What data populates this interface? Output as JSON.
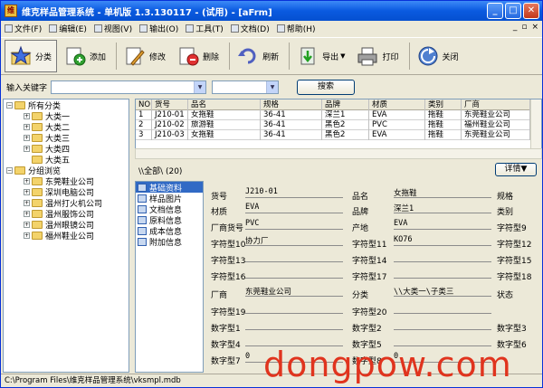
{
  "window": {
    "title": "维克样品管理系统 - 单机版 1.3.130117 - (试用) - [aFrm]"
  },
  "menu": [
    "文件(F)",
    "编辑(E)",
    "视图(V)",
    "输出(O)",
    "工具(T)",
    "文档(D)",
    "帮助(H)"
  ],
  "toolbar": {
    "classify": "分类",
    "add": "添加",
    "edit": "修改",
    "delete": "删除",
    "refresh": "刷新",
    "export": "导出",
    "print": "打印",
    "close": "关闭"
  },
  "search": {
    "label": "输入关键字",
    "button": "搜索",
    "value": "",
    "filter": ""
  },
  "tree": {
    "root1": "所有分类",
    "cats": [
      "大类一",
      "大类二",
      "大类三",
      "大类四",
      "大类五"
    ],
    "root2": "分组浏览",
    "groups": [
      "东莞鞋业公司",
      "深圳电脑公司",
      "温州打火机公司",
      "温州服饰公司",
      "温州眼镜公司",
      "福州鞋业公司"
    ]
  },
  "grid": {
    "headers": [
      "NO",
      "货号",
      "品名",
      "规格",
      "品牌",
      "材质",
      "类别",
      "厂商"
    ],
    "rows": [
      [
        "1",
        "J210-01",
        "女拖鞋",
        "36-41",
        "深兰1",
        "EVA",
        "拖鞋",
        "东莞鞋业公司"
      ],
      [
        "2",
        "J210-02",
        "旅游鞋",
        "36-41",
        "黑色2",
        "PVC",
        "拖鞋",
        "福州鞋业公司"
      ],
      [
        "3",
        "J210-03",
        "女拖鞋",
        "36-41",
        "黑色2",
        "EVA",
        "拖鞋",
        "东莞鞋业公司"
      ]
    ]
  },
  "path": {
    "text": "\\\\全部\\ (20)",
    "details": "详情▼"
  },
  "tabs": [
    "基础资料",
    "样品图片",
    "文档信息",
    "原料信息",
    "成本信息",
    "附加信息"
  ],
  "form": {
    "l_huohao": "货号",
    "v_huohao": "J210-01",
    "l_pinming": "品名",
    "v_pinming": "女拖鞋",
    "l_guige": "规格",
    "l_caizhi": "材质",
    "v_caizhi": "EVA",
    "l_pinpai": "品牌",
    "v_pinpai": "深兰1",
    "l_leibie": "类别",
    "l_changshanghh": "厂商货号",
    "v_changshanghh": "PVC",
    "l_chandi": "产地",
    "v_chandi": "EVA",
    "l_zfx9": "字符型9",
    "l_zfx10": "字符型10",
    "v_zfx10": "协力厂",
    "l_zfx11": "字符型11",
    "v_zfx11": "KO76",
    "l_zfx12": "字符型12",
    "l_zfx13": "字符型13",
    "l_zfx14": "字符型14",
    "l_zfx15": "字符型15",
    "l_zfx16": "字符型16",
    "l_zfx17": "字符型17",
    "l_zfx18": "字符型18",
    "l_changshang": "厂商",
    "v_changshang": "东莞鞋业公司",
    "l_fenlei": "分类",
    "v_fenlei": "\\\\大类一\\子类三",
    "l_zhuangtai": "状态",
    "l_zfx19": "字符型19",
    "l_zfx20": "字符型20",
    "l_szx1": "数字型1",
    "l_szx2": "数字型2",
    "l_szx3": "数字型3",
    "l_szx4": "数字型4",
    "l_szx5": "数字型5",
    "l_szx6": "数字型6",
    "l_szx7": "数字型7",
    "v_szx7": "0",
    "l_szx8": "数字型8",
    "v_szx8": "0"
  },
  "status": "C:\\Program Files\\维克样品管理系统\\vksmpl.mdb",
  "watermark": "dongpow.com"
}
